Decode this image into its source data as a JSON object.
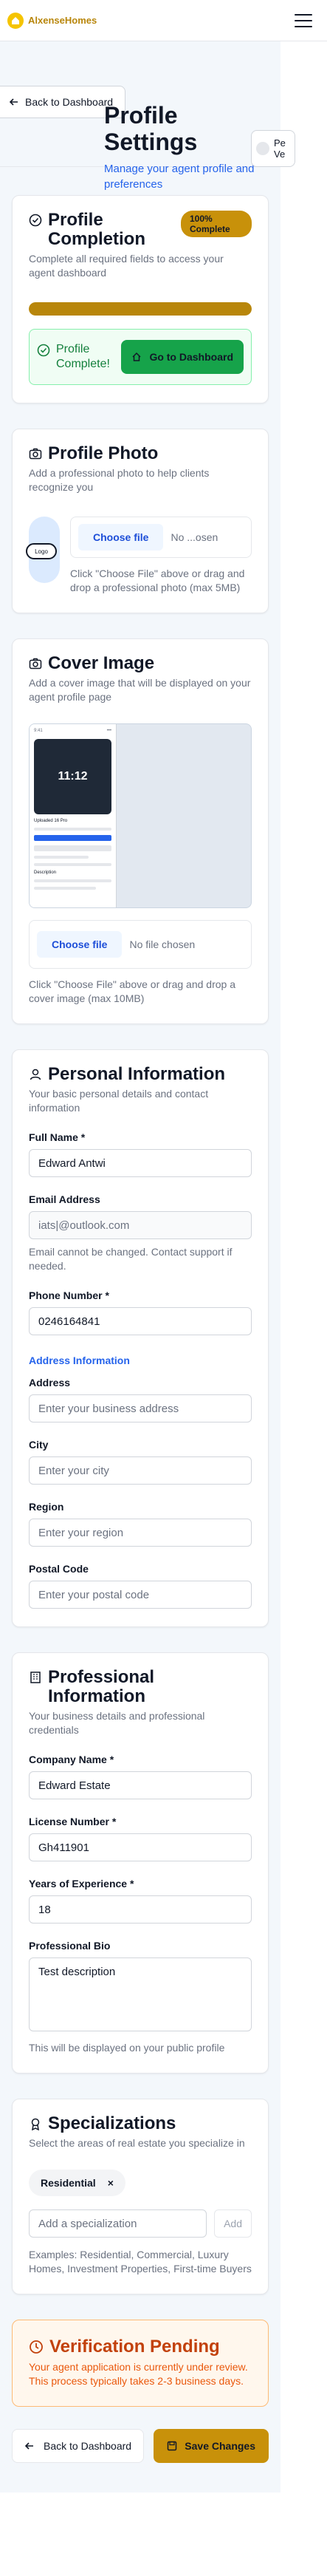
{
  "brand": {
    "name": "AlxenseHomes"
  },
  "header": {
    "back_label": "Back to Dashboard",
    "title": "Profile Settings",
    "subtitle": "Manage your agent profile and preferences",
    "preview_label": "Pe Ve"
  },
  "completion": {
    "title": "Profile Completion",
    "badge": "100% Complete",
    "description": "Complete all required fields to access your agent dashboard",
    "progress_percent": 100,
    "complete_text": "Profile Complete!",
    "button_label": "Go to Dashboard"
  },
  "photo": {
    "title": "Profile Photo",
    "description": "Add a professional photo to help clients recognize you",
    "avatar_text": "Logo",
    "choose_label": "Choose file",
    "file_status": "No ...osen",
    "hint": "Click \"Choose File\" above or drag and drop a professional photo (max 5MB)"
  },
  "cover": {
    "title": "Cover Image",
    "description": "Add a cover image that will be displayed on your agent profile page",
    "preview_time": "11:12",
    "preview_caption": "Uploaded 16 Pro",
    "preview_label": "Description",
    "choose_label": "Choose file",
    "file_status": "No file chosen",
    "hint": "Click \"Choose File\" above or drag and drop a cover image (max 10MB)"
  },
  "personal": {
    "title": "Personal Information",
    "description": "Your basic personal details and contact information",
    "full_name_label": "Full Name *",
    "full_name": "Edward Antwi",
    "email_label": "Email Address",
    "email_placeholder": "iats|@outlook.com",
    "email_help": "Email cannot be changed. Contact support if needed.",
    "phone_label": "Phone Number *",
    "phone": "0246164841",
    "address_section": "Address Information",
    "address_label": "Address",
    "address_placeholder": "Enter your business address",
    "city_label": "City",
    "city_placeholder": "Enter your city",
    "region_label": "Region",
    "region_placeholder": "Enter your region",
    "postal_label": "Postal Code",
    "postal_placeholder": "Enter your postal code"
  },
  "professional": {
    "title": "Professional Information",
    "description": "Your business details and professional credentials",
    "company_label": "Company Name *",
    "company": "Edward Estate",
    "license_label": "License Number *",
    "license": "Gh411901",
    "experience_label": "Years of Experience *",
    "experience": "18",
    "bio_label": "Professional Bio",
    "bio": "Test description",
    "bio_help": "This will be displayed on your public profile"
  },
  "specializations": {
    "title": "Specializations",
    "description": "Select the areas of real estate you specialize in",
    "tags": [
      "Residential"
    ],
    "remove_symbol": "×",
    "input_placeholder": "Add a specialization",
    "add_label": "Add",
    "examples": "Examples: Residential, Commercial, Luxury Homes, Investment Properties, First-time Buyers"
  },
  "verification": {
    "title": "Verification Pending",
    "text": "Your agent application is currently under review. This process typically takes 2-3 business days."
  },
  "footer": {
    "back_label": "Back to Dashboard",
    "save_label": "Save Changes"
  },
  "colors": {
    "accent": "#c8910a",
    "success": "#16a34a",
    "warning": "#ea580c",
    "link": "#2563eb"
  }
}
